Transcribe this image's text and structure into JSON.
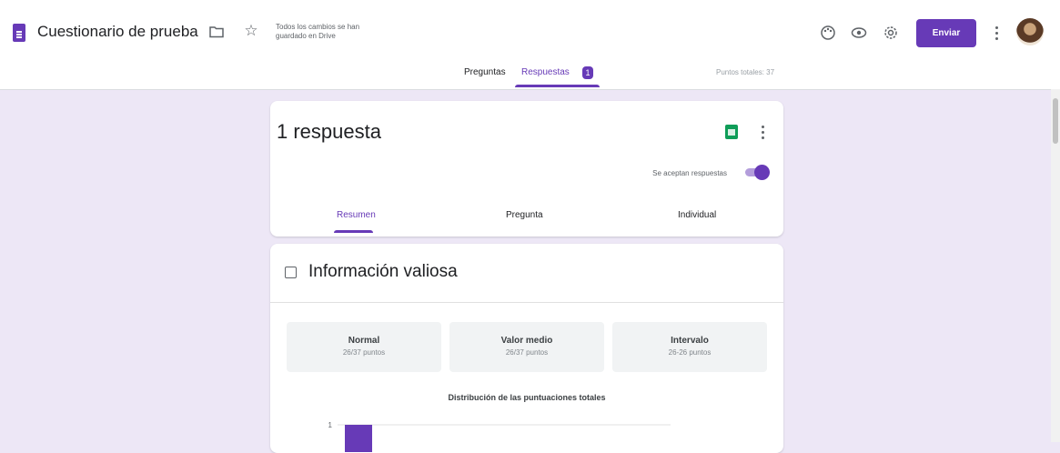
{
  "header": {
    "title": "Cuestionario de prueba",
    "save_status": "Todos los cambios se han guardado en Drive",
    "send_label": "Enviar",
    "icons": [
      "folder-icon",
      "star-icon",
      "palette-icon",
      "preview-icon",
      "settings-icon",
      "more-vert-icon"
    ]
  },
  "nav": {
    "tabs": [
      "Preguntas",
      "Respuestas"
    ],
    "active_tab": "Respuestas",
    "response_badge": "1",
    "total_points": "Puntos totales: 37"
  },
  "responses_card": {
    "count_text": "1 respuesta",
    "accepting_label": "Se aceptan respuestas",
    "accepting": true,
    "subtabs": [
      "Resumen",
      "Pregunta",
      "Individual"
    ],
    "active_subtab": "Resumen"
  },
  "insights_card": {
    "title": "Información valiosa",
    "stats": [
      {
        "label": "Normal",
        "value": "26/37 puntos"
      },
      {
        "label": "Valor medio",
        "value": "26/37 puntos"
      },
      {
        "label": "Intervalo",
        "value": "26-26 puntos"
      }
    ],
    "distribution_title": "Distribución de las puntuaciones totales"
  },
  "chart_data": {
    "type": "bar",
    "title": "Distribución de las puntuaciones totales",
    "y_ticks": [
      "1"
    ],
    "values": [
      1
    ],
    "ylim": [
      0,
      1
    ]
  },
  "colors": {
    "accent": "#673ab7",
    "background": "#ede7f6",
    "sheets_green": "#0f9d58"
  }
}
